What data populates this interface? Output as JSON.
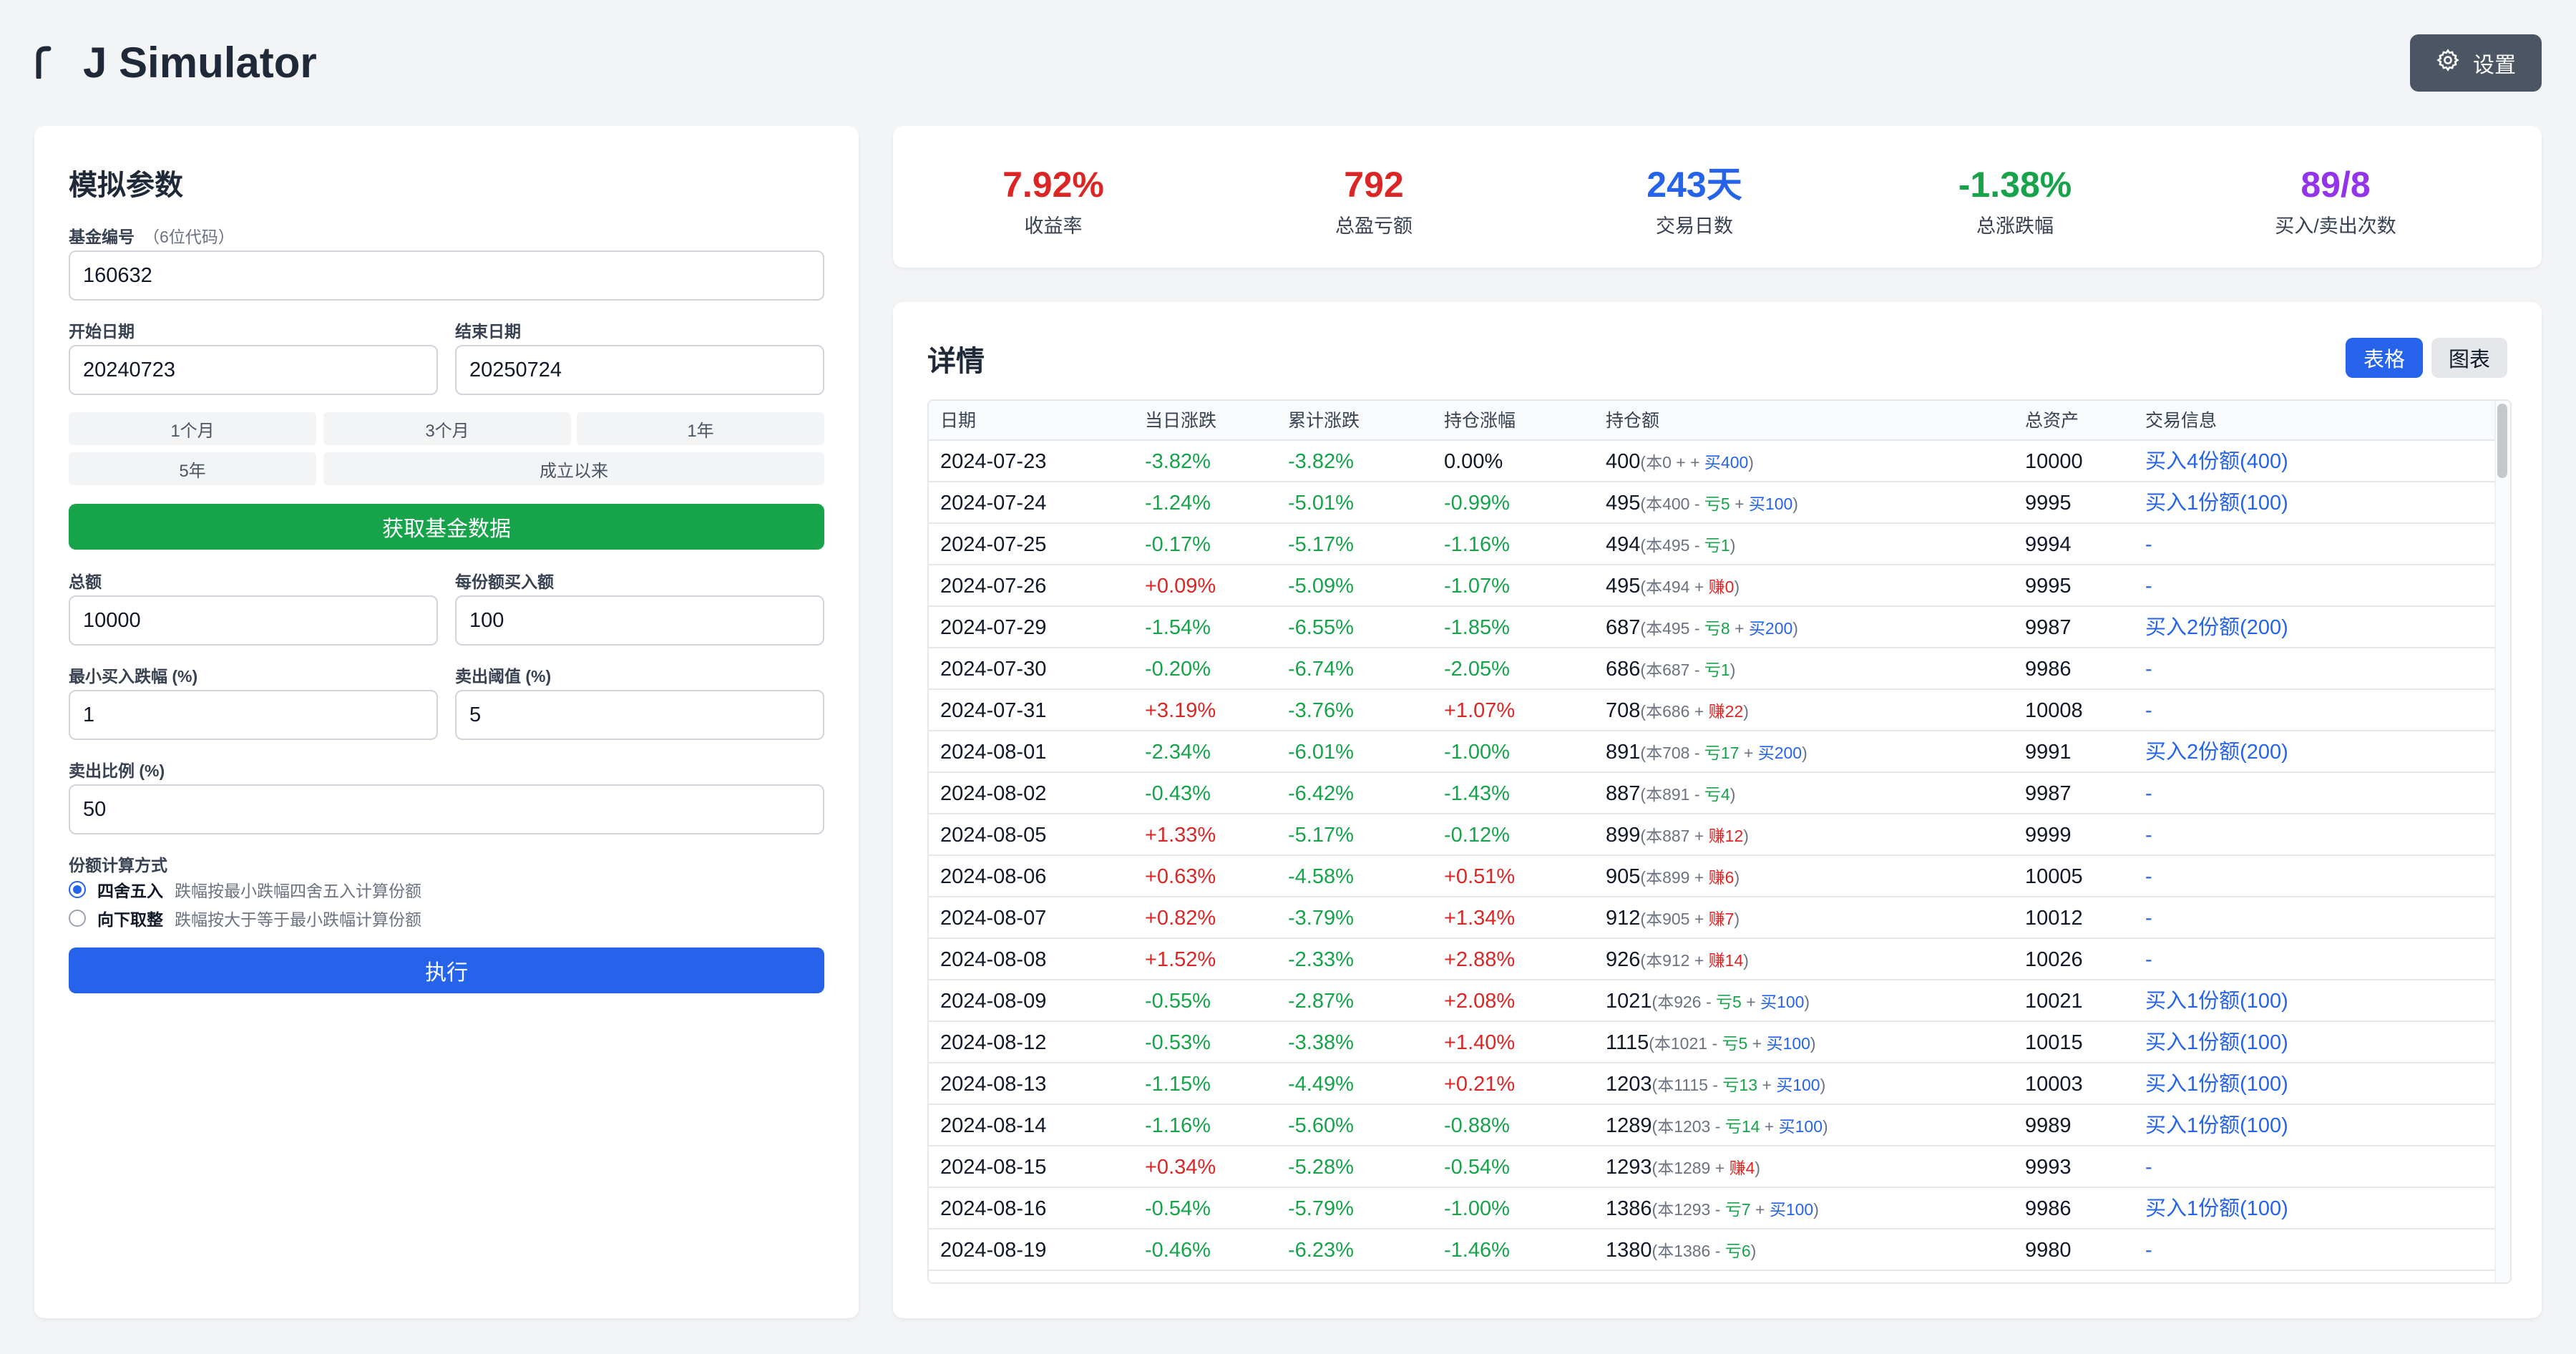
{
  "app": {
    "title": "J Simulator"
  },
  "header": {
    "settings_label": "设置"
  },
  "params": {
    "title": "模拟参数",
    "fund_code_label": "基金编号",
    "fund_code_hint": "（6位代码）",
    "fund_code": "160632",
    "start_date_label": "开始日期",
    "start_date": "20240723",
    "end_date_label": "结束日期",
    "end_date": "20250724",
    "quick_ranges": [
      "1个月",
      "3个月",
      "1年",
      "5年",
      "成立以来"
    ],
    "fetch_button": "获取基金数据",
    "total_label": "总额",
    "total": "10000",
    "per_share_label": "每份额买入额",
    "per_share": "100",
    "min_drop_label": "最小买入跌幅 (%)",
    "min_drop": "1",
    "sell_threshold_label": "卖出阈值 (%)",
    "sell_threshold": "5",
    "sell_ratio_label": "卖出比例 (%)",
    "sell_ratio": "50",
    "calc_method_label": "份额计算方式",
    "calc_options": [
      {
        "label": "四舍五入",
        "desc": "跌幅按最小跌幅四舍五入计算份额",
        "selected": true
      },
      {
        "label": "向下取整",
        "desc": "跌幅按大于等于最小跌幅计算份额",
        "selected": false
      }
    ],
    "run_button": "执行"
  },
  "stats": [
    {
      "value": "7.92%",
      "label": "收益率",
      "color": "#dc2626"
    },
    {
      "value": "792",
      "label": "总盈亏额",
      "color": "#dc2626"
    },
    {
      "value": "243天",
      "label": "交易日数",
      "color": "#2563eb"
    },
    {
      "value": "-1.38%",
      "label": "总涨跌幅",
      "color": "#16a34a"
    },
    {
      "value": "89/8",
      "label": "买入/卖出次数",
      "color": "#9333ea"
    }
  ],
  "details": {
    "title": "详情",
    "view_table": "表格",
    "view_chart": "图表",
    "columns": [
      "日期",
      "当日涨跌",
      "累计涨跌",
      "持仓涨幅",
      "持仓额",
      "总资产",
      "交易信息"
    ],
    "rows": [
      {
        "date": "2024-07-23",
        "daily": "-3.82%",
        "cum": "-3.82%",
        "pos": "0.00%",
        "holding": "400",
        "base": "本0",
        "pl_sign": "+",
        "pl": "",
        "buy": "买400",
        "total": "10000",
        "trade": "买入4份额(400)"
      },
      {
        "date": "2024-07-24",
        "daily": "-1.24%",
        "cum": "-5.01%",
        "pos": "-0.99%",
        "holding": "495",
        "base": "本400",
        "pl_sign": "-",
        "pl": "亏5",
        "buy": "买100",
        "total": "9995",
        "trade": "买入1份额(100)"
      },
      {
        "date": "2024-07-25",
        "daily": "-0.17%",
        "cum": "-5.17%",
        "pos": "-1.16%",
        "holding": "494",
        "base": "本495",
        "pl_sign": "-",
        "pl": "亏1",
        "buy": "",
        "total": "9994",
        "trade": "-"
      },
      {
        "date": "2024-07-26",
        "daily": "+0.09%",
        "cum": "-5.09%",
        "pos": "-1.07%",
        "holding": "495",
        "base": "本494",
        "pl_sign": "+",
        "pl": "赚0",
        "buy": "",
        "total": "9995",
        "trade": "-"
      },
      {
        "date": "2024-07-29",
        "daily": "-1.54%",
        "cum": "-6.55%",
        "pos": "-1.85%",
        "holding": "687",
        "base": "本495",
        "pl_sign": "-",
        "pl": "亏8",
        "buy": "买200",
        "total": "9987",
        "trade": "买入2份额(200)"
      },
      {
        "date": "2024-07-30",
        "daily": "-0.20%",
        "cum": "-6.74%",
        "pos": "-2.05%",
        "holding": "686",
        "base": "本687",
        "pl_sign": "-",
        "pl": "亏1",
        "buy": "",
        "total": "9986",
        "trade": "-"
      },
      {
        "date": "2024-07-31",
        "daily": "+3.19%",
        "cum": "-3.76%",
        "pos": "+1.07%",
        "holding": "708",
        "base": "本686",
        "pl_sign": "+",
        "pl": "赚22",
        "buy": "",
        "total": "10008",
        "trade": "-"
      },
      {
        "date": "2024-08-01",
        "daily": "-2.34%",
        "cum": "-6.01%",
        "pos": "-1.00%",
        "holding": "891",
        "base": "本708",
        "pl_sign": "-",
        "pl": "亏17",
        "buy": "买200",
        "total": "9991",
        "trade": "买入2份额(200)"
      },
      {
        "date": "2024-08-02",
        "daily": "-0.43%",
        "cum": "-6.42%",
        "pos": "-1.43%",
        "holding": "887",
        "base": "本891",
        "pl_sign": "-",
        "pl": "亏4",
        "buy": "",
        "total": "9987",
        "trade": "-"
      },
      {
        "date": "2024-08-05",
        "daily": "+1.33%",
        "cum": "-5.17%",
        "pos": "-0.12%",
        "holding": "899",
        "base": "本887",
        "pl_sign": "+",
        "pl": "赚12",
        "buy": "",
        "total": "9999",
        "trade": "-"
      },
      {
        "date": "2024-08-06",
        "daily": "+0.63%",
        "cum": "-4.58%",
        "pos": "+0.51%",
        "holding": "905",
        "base": "本899",
        "pl_sign": "+",
        "pl": "赚6",
        "buy": "",
        "total": "10005",
        "trade": "-"
      },
      {
        "date": "2024-08-07",
        "daily": "+0.82%",
        "cum": "-3.79%",
        "pos": "+1.34%",
        "holding": "912",
        "base": "本905",
        "pl_sign": "+",
        "pl": "赚7",
        "buy": "",
        "total": "10012",
        "trade": "-"
      },
      {
        "date": "2024-08-08",
        "daily": "+1.52%",
        "cum": "-2.33%",
        "pos": "+2.88%",
        "holding": "926",
        "base": "本912",
        "pl_sign": "+",
        "pl": "赚14",
        "buy": "",
        "total": "10026",
        "trade": "-"
      },
      {
        "date": "2024-08-09",
        "daily": "-0.55%",
        "cum": "-2.87%",
        "pos": "+2.08%",
        "holding": "1021",
        "base": "本926",
        "pl_sign": "-",
        "pl": "亏5",
        "buy": "买100",
        "total": "10021",
        "trade": "买入1份额(100)"
      },
      {
        "date": "2024-08-12",
        "daily": "-0.53%",
        "cum": "-3.38%",
        "pos": "+1.40%",
        "holding": "1115",
        "base": "本1021",
        "pl_sign": "-",
        "pl": "亏5",
        "buy": "买100",
        "total": "10015",
        "trade": "买入1份额(100)"
      },
      {
        "date": "2024-08-13",
        "daily": "-1.15%",
        "cum": "-4.49%",
        "pos": "+0.21%",
        "holding": "1203",
        "base": "本1115",
        "pl_sign": "-",
        "pl": "亏13",
        "buy": "买100",
        "total": "10003",
        "trade": "买入1份额(100)"
      },
      {
        "date": "2024-08-14",
        "daily": "-1.16%",
        "cum": "-5.60%",
        "pos": "-0.88%",
        "holding": "1289",
        "base": "本1203",
        "pl_sign": "-",
        "pl": "亏14",
        "buy": "买100",
        "total": "9989",
        "trade": "买入1份额(100)"
      },
      {
        "date": "2024-08-15",
        "daily": "+0.34%",
        "cum": "-5.28%",
        "pos": "-0.54%",
        "holding": "1293",
        "base": "本1289",
        "pl_sign": "+",
        "pl": "赚4",
        "buy": "",
        "total": "9993",
        "trade": "-"
      },
      {
        "date": "2024-08-16",
        "daily": "-0.54%",
        "cum": "-5.79%",
        "pos": "-1.00%",
        "holding": "1386",
        "base": "本1293",
        "pl_sign": "-",
        "pl": "亏7",
        "buy": "买100",
        "total": "9986",
        "trade": "买入1份额(100)"
      },
      {
        "date": "2024-08-19",
        "daily": "-0.46%",
        "cum": "-6.23%",
        "pos": "-1.46%",
        "holding": "1380",
        "base": "本1386",
        "pl_sign": "-",
        "pl": "亏6",
        "buy": "",
        "total": "9980",
        "trade": "-"
      }
    ]
  }
}
